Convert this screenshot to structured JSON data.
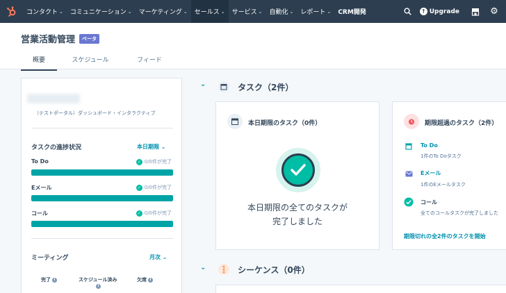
{
  "nav": {
    "items": [
      {
        "label": "コンタクト",
        "active": false
      },
      {
        "label": "コミュニケーション",
        "active": false
      },
      {
        "label": "マーケティング",
        "active": false
      },
      {
        "label": "セールス",
        "active": true
      },
      {
        "label": "サービス",
        "active": false
      },
      {
        "label": "自動化",
        "active": false
      },
      {
        "label": "レポート",
        "active": false
      },
      {
        "label": "CRM開発",
        "active": false
      }
    ],
    "upgrade_label": "Upgrade",
    "icons": [
      "hubspot-logo-icon",
      "search-icon",
      "marketplace-icon",
      "settings-gear-icon"
    ]
  },
  "header": {
    "title": "営業活動管理",
    "badge": "ベータ",
    "tabs": [
      {
        "label": "概要",
        "active": true
      },
      {
        "label": "スケジュール",
        "active": false
      },
      {
        "label": "フィード",
        "active": false
      }
    ]
  },
  "left": {
    "subname": "（テストポータル）ダッシュボード・インタラクティブ",
    "progress_title": "タスクの進捗状況",
    "progress_filter": "本日期限",
    "rows": [
      {
        "label": "To Do",
        "status": "0/0件が完了",
        "fill": 1.0
      },
      {
        "label": "Eメール",
        "status": "0/0件が完了",
        "fill": 1.0
      },
      {
        "label": "コール",
        "status": "0/0件が完了",
        "fill": 1.0
      }
    ],
    "meeting_title": "ミーティング",
    "meeting_filter": "月次",
    "meeting_cols": [
      "完了",
      "スケジュール済み",
      "欠席"
    ]
  },
  "tasks": {
    "header": "タスク（2件）",
    "due_today": {
      "title": "本日期限のタスク（0件）",
      "message_line1": "本日期限の全てのタスクが",
      "message_line2": "完了しました"
    },
    "overdue": {
      "title": "期限超過のタスク（2件）",
      "items": [
        {
          "title": "To Do",
          "sub": "1件のTo Doタスク",
          "icon": "todo-icon"
        },
        {
          "title": "Eメール",
          "sub": "1件のEメールタスク",
          "icon": "email-icon"
        },
        {
          "title": "コール",
          "sub": "全てのコールタスクが完了しました",
          "icon": "check-icon"
        }
      ],
      "view_all": "期限切れの全2件のタスクを開始"
    }
  },
  "sequences": {
    "header": "シーケンス（0件）"
  },
  "colors": {
    "nav_bg": "#2d3e50",
    "accent_teal": "#00bda5",
    "bar_teal": "#00a4a6",
    "link": "#0091ae",
    "beta": "#6a78d1",
    "alert_red": "#f2545b"
  }
}
